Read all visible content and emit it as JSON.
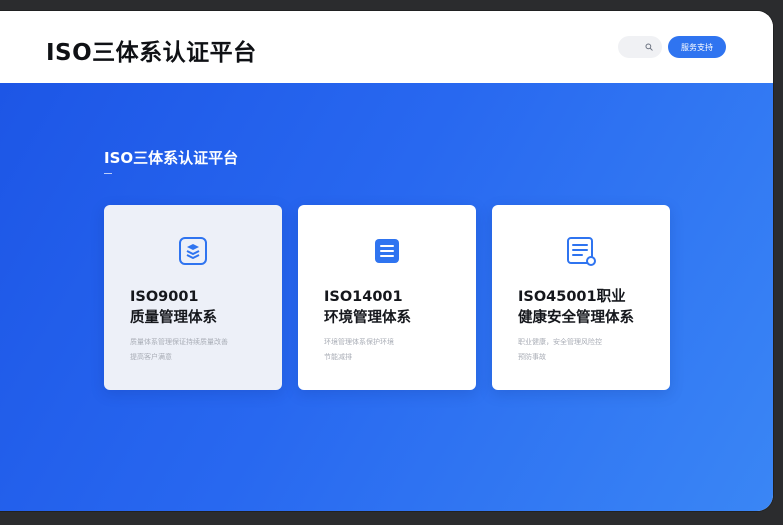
{
  "header": {
    "brand": "ISO三体系认证平台",
    "cta_label": "服务支持"
  },
  "icons": {
    "search": "search-icon",
    "card1": "shield-layers-icon",
    "card2": "document-list-icon",
    "card3": "certificate-doc-icon"
  },
  "colors": {
    "accent": "#2f74f0",
    "hero_start": "#1d56e6",
    "hero_end": "#3a86f5"
  },
  "hero": {
    "section_title": "ISO三体系认证平台"
  },
  "cards": [
    {
      "title_line1": "ISO9001",
      "title_line2": "质量管理体系",
      "desc_line1": "质量体系管理保证持续质量改善",
      "desc_line2": "提高客户满意"
    },
    {
      "title_line1": "ISO14001",
      "title_line2": "环境管理体系",
      "desc_line1": "环境管理体系保护环境",
      "desc_line2": "节能减排"
    },
    {
      "title_line1": "ISO45001职业",
      "title_line2": "健康安全管理体系",
      "desc_line1": "职业健康，安全管理风险控",
      "desc_line2": "预防事故"
    }
  ]
}
